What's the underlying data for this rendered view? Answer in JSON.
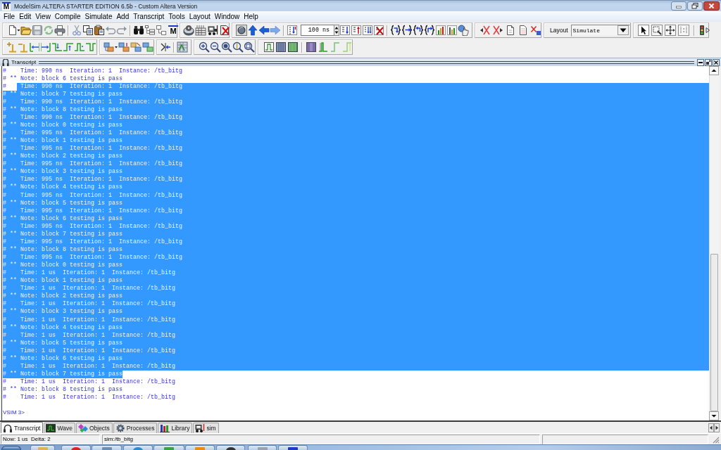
{
  "window": {
    "logo": "M",
    "title": "ModelSim ALTERA STARTER EDITION 6.5b - Custom Altera Version"
  },
  "menu_bar": [
    "File",
    "Edit",
    "View",
    "Compile",
    "Simulate",
    "Add",
    "Transcript",
    "Tools",
    "Layout",
    "Window",
    "Help"
  ],
  "toolbar": {
    "logo_button": "M",
    "run_length": {
      "value": "100 ns"
    },
    "layout": {
      "label": "Layout",
      "value": "Simulate"
    }
  },
  "transcript": {
    "title": "Transcript",
    "lines": [
      {
        "text": "#    Time: 990 ns  Iteration: 1  Instance: /tb_bitg",
        "selected": false
      },
      {
        "text": "# ** Note: block 6 testing is pass",
        "selected": false
      },
      {
        "text": "#    Time: 990 ns  Iteration: 1  Instance: /tb_bitg",
        "selected": true,
        "selection_starts_at_text": true
      },
      {
        "text": "# ** Note: block 7 testing is pass",
        "selected": true
      },
      {
        "text": "#    Time: 990 ns  Iteration: 1  Instance: /tb_bitg",
        "selected": true
      },
      {
        "text": "# ** Note: block 8 testing is pass",
        "selected": true
      },
      {
        "text": "#    Time: 990 ns  Iteration: 1  Instance: /tb_bitg",
        "selected": true
      },
      {
        "text": "# ** Note: block 0 testing is pass",
        "selected": true
      },
      {
        "text": "#    Time: 995 ns  Iteration: 1  Instance: /tb_bitg",
        "selected": true
      },
      {
        "text": "# ** Note: block 1 testing is pass",
        "selected": true
      },
      {
        "text": "#    Time: 995 ns  Iteration: 1  Instance: /tb_bitg",
        "selected": true
      },
      {
        "text": "# ** Note: block 2 testing is pass",
        "selected": true
      },
      {
        "text": "#    Time: 995 ns  Iteration: 1  Instance: /tb_bitg",
        "selected": true
      },
      {
        "text": "# ** Note: block 3 testing is pass",
        "selected": true
      },
      {
        "text": "#    Time: 995 ns  Iteration: 1  Instance: /tb_bitg",
        "selected": true
      },
      {
        "text": "# ** Note: block 4 testing is pass",
        "selected": true
      },
      {
        "text": "#    Time: 995 ns  Iteration: 1  Instance: /tb_bitg",
        "selected": true
      },
      {
        "text": "# ** Note: block 5 testing is pass",
        "selected": true
      },
      {
        "text": "#    Time: 995 ns  Iteration: 1  Instance: /tb_bitg",
        "selected": true
      },
      {
        "text": "# ** Note: block 6 testing is pass",
        "selected": true
      },
      {
        "text": "#    Time: 995 ns  Iteration: 1  Instance: /tb_bitg",
        "selected": true
      },
      {
        "text": "# ** Note: block 7 testing is pass",
        "selected": true
      },
      {
        "text": "#    Time: 995 ns  Iteration: 1  Instance: /tb_bitg",
        "selected": true
      },
      {
        "text": "# ** Note: block 8 testing is pass",
        "selected": true
      },
      {
        "text": "#    Time: 995 ns  Iteration: 1  Instance: /tb_bitg",
        "selected": true
      },
      {
        "text": "# ** Note: block 0 testing is pass",
        "selected": true
      },
      {
        "text": "#    Time: 1 us  Iteration: 1  Instance: /tb_bitg",
        "selected": true
      },
      {
        "text": "# ** Note: block 1 testing is pass",
        "selected": true
      },
      {
        "text": "#    Time: 1 us  Iteration: 1  Instance: /tb_bitg",
        "selected": true
      },
      {
        "text": "# ** Note: block 2 testing is pass",
        "selected": true
      },
      {
        "text": "#    Time: 1 us  Iteration: 1  Instance: /tb_bitg",
        "selected": true
      },
      {
        "text": "# ** Note: block 3 testing is pass",
        "selected": true
      },
      {
        "text": "#    Time: 1 us  Iteration: 1  Instance: /tb_bitg",
        "selected": true
      },
      {
        "text": "# ** Note: block 4 testing is pass",
        "selected": true
      },
      {
        "text": "#    Time: 1 us  Iteration: 1  Instance: /tb_bitg",
        "selected": true
      },
      {
        "text": "# ** Note: block 5 testing is pass",
        "selected": true
      },
      {
        "text": "#    Time: 1 us  Iteration: 1  Instance: /tb_bitg",
        "selected": true
      },
      {
        "text": "# ** Note: block 6 testing is pass",
        "selected": true
      },
      {
        "text": "#    Time: 1 us  Iteration: 1  Instance: /tb_bitg",
        "selected": true
      },
      {
        "text": "# ** Note: block 7 testing is pass",
        "selected": true,
        "selection_ends_at_text": true
      },
      {
        "text": "#    Time: 1 us  Iteration: 1  Instance: /tb_bitg",
        "selected": false
      },
      {
        "text": "# ** Note: block 8 testing is pass",
        "selected": false
      },
      {
        "text": "#    Time: 1 us  Iteration: 1  Instance: /tb_bitg",
        "selected": false
      }
    ],
    "prompt": "VSIM 3>"
  },
  "tabs": [
    {
      "label": "Transcript",
      "selected": true
    },
    {
      "label": "Wave",
      "selected": false
    },
    {
      "label": "Objects",
      "selected": false
    },
    {
      "label": "Processes",
      "selected": false
    },
    {
      "label": "Library",
      "selected": false
    },
    {
      "label": "sim",
      "selected": false
    }
  ],
  "status_bar": {
    "time": "Now: 1 us  Delta: 2",
    "context": "sim:/tb_bitg"
  }
}
